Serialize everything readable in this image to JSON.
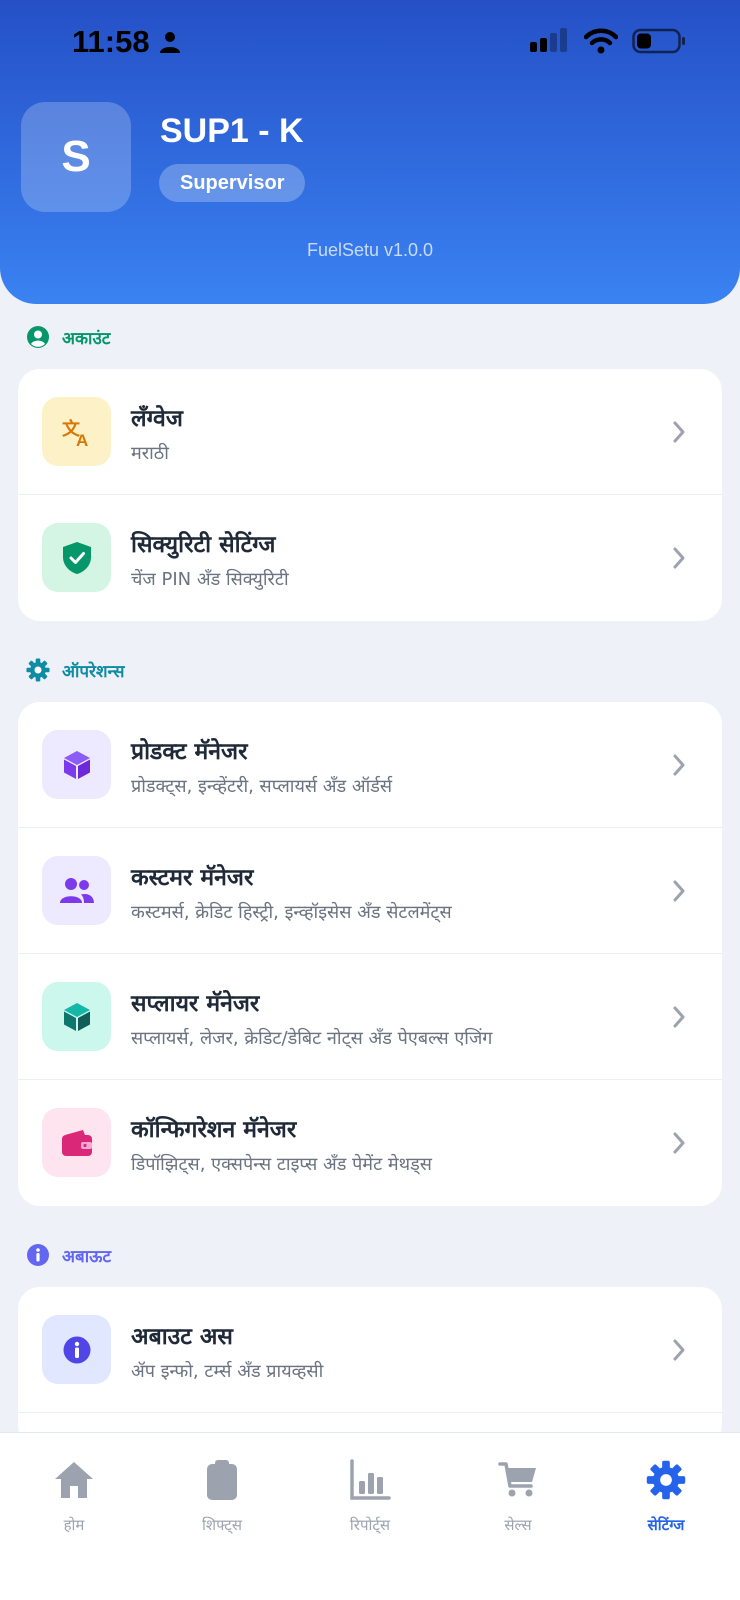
{
  "status_bar": {
    "time": "11:58"
  },
  "profile": {
    "initial": "S",
    "name": "SUP1 - K",
    "role": "Supervisor",
    "app_version": "FuelSetu v1.0.0"
  },
  "sections": {
    "account": {
      "title": "अकाउंट",
      "items": [
        {
          "title": "लँग्वेज",
          "subtitle": "मराठी",
          "icon": "translate-icon"
        },
        {
          "title": "सिक्युरिटी सेटिंग्ज",
          "subtitle": "चेंज PIN अँड सिक्युरिटी",
          "icon": "shield-check-icon"
        }
      ]
    },
    "operations": {
      "title": "ऑपरेशन्स",
      "items": [
        {
          "title": "प्रोडक्ट मॅनेजर",
          "subtitle": "प्रोडक्ट्स, इन्व्हेंटरी, सप्लायर्स अँड ऑर्डर्स",
          "icon": "cube-icon"
        },
        {
          "title": "कस्टमर मॅनेजर",
          "subtitle": "कस्टमर्स, क्रेडिट हिस्ट्री, इन्व्हॉइसेस अँड सेटलमेंट्स",
          "icon": "users-icon"
        },
        {
          "title": "सप्लायर मॅनेजर",
          "subtitle": "सप्लायर्स, लेजर, क्रेडिट/डेबिट नोट्स अँड पेएबल्स एजिंग",
          "icon": "box-icon"
        },
        {
          "title": "कॉन्फिगरेशन मॅनेजर",
          "subtitle": "डिपॉझिट्स, एक्सपेन्स टाइप्स अँड पेमेंट मेथड्स",
          "icon": "wallet-icon"
        }
      ]
    },
    "about": {
      "title": "अबाऊट",
      "items": [
        {
          "title": "अबाउट अस",
          "subtitle": "ॲप इन्फो, टर्म्स अँड प्रायव्हसी",
          "icon": "info-icon"
        }
      ]
    }
  },
  "bottom_nav": {
    "active": "सेटिंग्ज",
    "items": [
      {
        "label": "होम",
        "icon": "home-icon"
      },
      {
        "label": "शिफ्ट्स",
        "icon": "clipboard-icon"
      },
      {
        "label": "रिपोर्ट्स",
        "icon": "bar-chart-icon"
      },
      {
        "label": "सेल्स",
        "icon": "cart-icon"
      },
      {
        "label": "सेटिंग्ज",
        "icon": "gear-icon"
      }
    ]
  },
  "colors": {
    "header_gradient_top": "#2550c6",
    "header_gradient_bottom": "#3a82f2",
    "account_accent": "#059669",
    "operations_accent": "#0e8ca3",
    "about_accent": "#6366f1",
    "nav_active": "#2563eb"
  }
}
